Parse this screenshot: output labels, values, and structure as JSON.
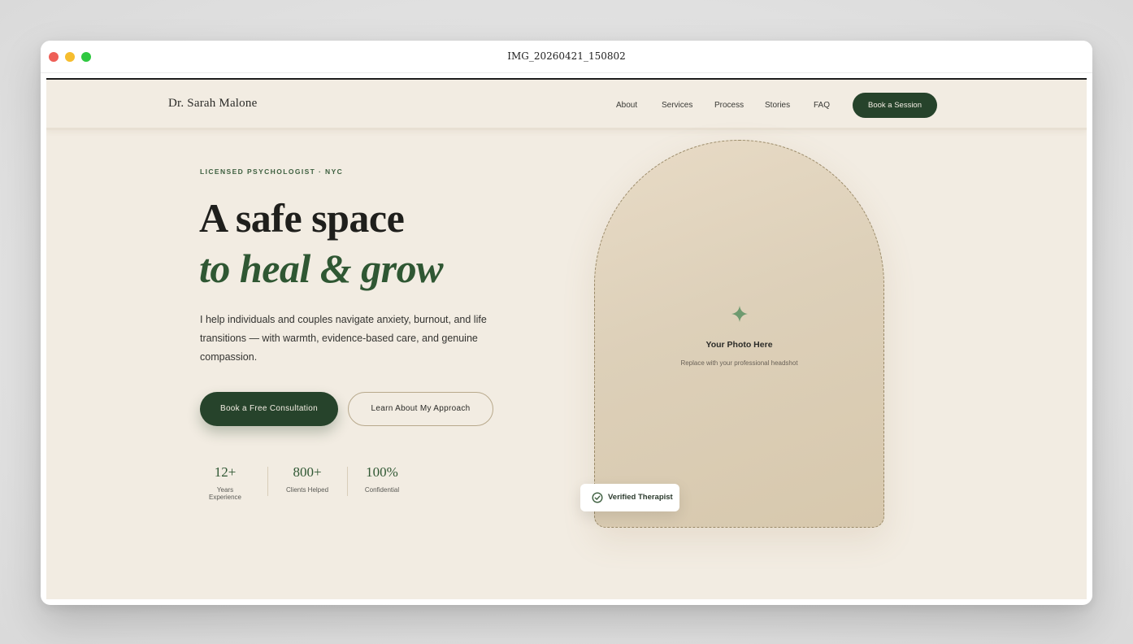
{
  "window": {
    "title": "IMG_20260421_150802"
  },
  "nav": {
    "brand": "Dr. Sarah Malone",
    "links": [
      "About",
      "Services",
      "Process",
      "Stories",
      "FAQ"
    ],
    "cta": "Book a Session"
  },
  "hero": {
    "eyebrow": "LICENSED PSYCHOLOGIST · NYC",
    "headline_line1": "A safe space",
    "headline_line2": "to heal & grow",
    "lead": "I help individuals and couples navigate anxiety, burnout, and life transitions — with warmth, evidence-based care, and genuine compassion.",
    "primary_cta": "Book a Free Consultation",
    "secondary_cta": "Learn About My Approach",
    "stats": [
      {
        "value": "12+",
        "label": "Years Experience"
      },
      {
        "value": "800+",
        "label": "Clients Helped"
      },
      {
        "value": "100%",
        "label": "Confidential"
      }
    ]
  },
  "photo": {
    "icon": "sparkle-icon",
    "title": "Your Photo Here",
    "subtitle": "Replace with your professional headshot"
  },
  "badge": {
    "icon": "check-circle-icon",
    "label": "Verified Therapist"
  },
  "colors": {
    "background": "#f2ece2",
    "primary_green": "#26432b",
    "accent_green": "#2f5733",
    "sparkle": "#6e9a6f"
  }
}
